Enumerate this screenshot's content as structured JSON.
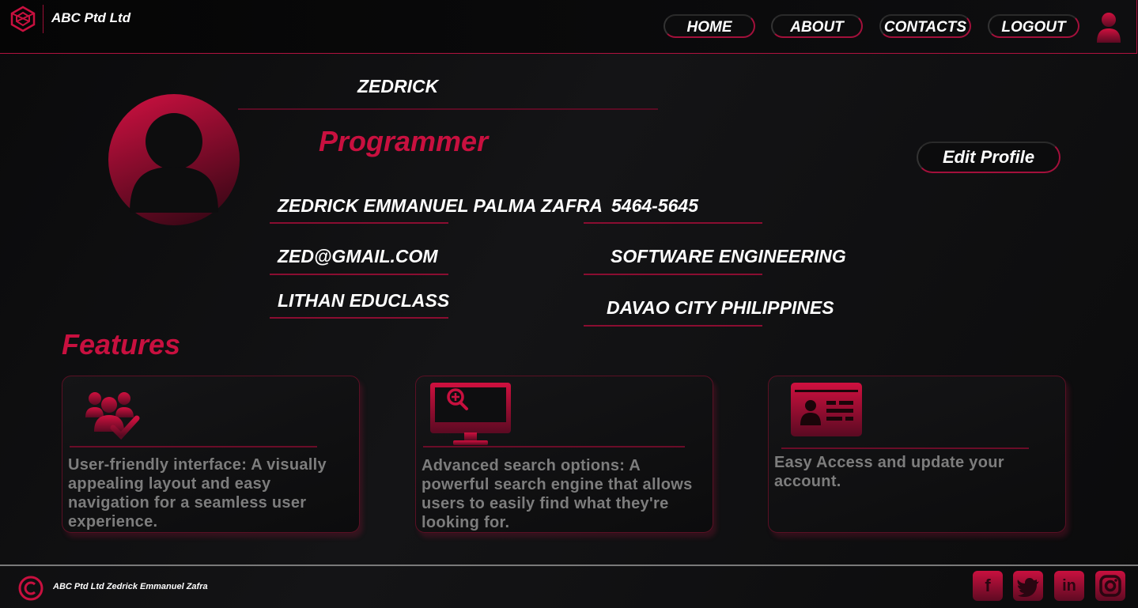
{
  "header": {
    "brand": "ABC Ptd Ltd",
    "nav": [
      "HOME",
      "ABOUT",
      "CONTACTS",
      "LOGOUT"
    ]
  },
  "profile": {
    "username": "ZEDRICK",
    "role": "Programmer",
    "edit_label": "Edit Profile",
    "full_name": "ZEDRICK EMMANUEL PALMA ZAFRA",
    "phone": "5464-5645",
    "email": "ZED@GMAIL.COM",
    "course": "SOFTWARE ENGINEERING",
    "school": "LITHAN EDUCLASS",
    "location": "DAVAO CITY PHILIPPINES"
  },
  "features": {
    "title": "Features",
    "cards": [
      {
        "icon": "users-check-icon",
        "text": "User-friendly interface: A visually appealing layout and easy navigation for a seamless user experience."
      },
      {
        "icon": "monitor-search-icon",
        "text": "Advanced search options: A powerful search engine that allows users to easily find what they're looking for."
      },
      {
        "icon": "id-card-icon",
        "text": "Easy Access and update your account."
      }
    ]
  },
  "footer": {
    "text": "ABC Ptd Ltd Zedrick Emmanuel Zafra",
    "social": [
      "facebook-icon",
      "twitter-icon",
      "linkedin-icon",
      "instagram-icon"
    ]
  },
  "colors": {
    "accent": "#c8103f",
    "background": "#0f0f10",
    "muted_text": "#7d7d7d"
  }
}
